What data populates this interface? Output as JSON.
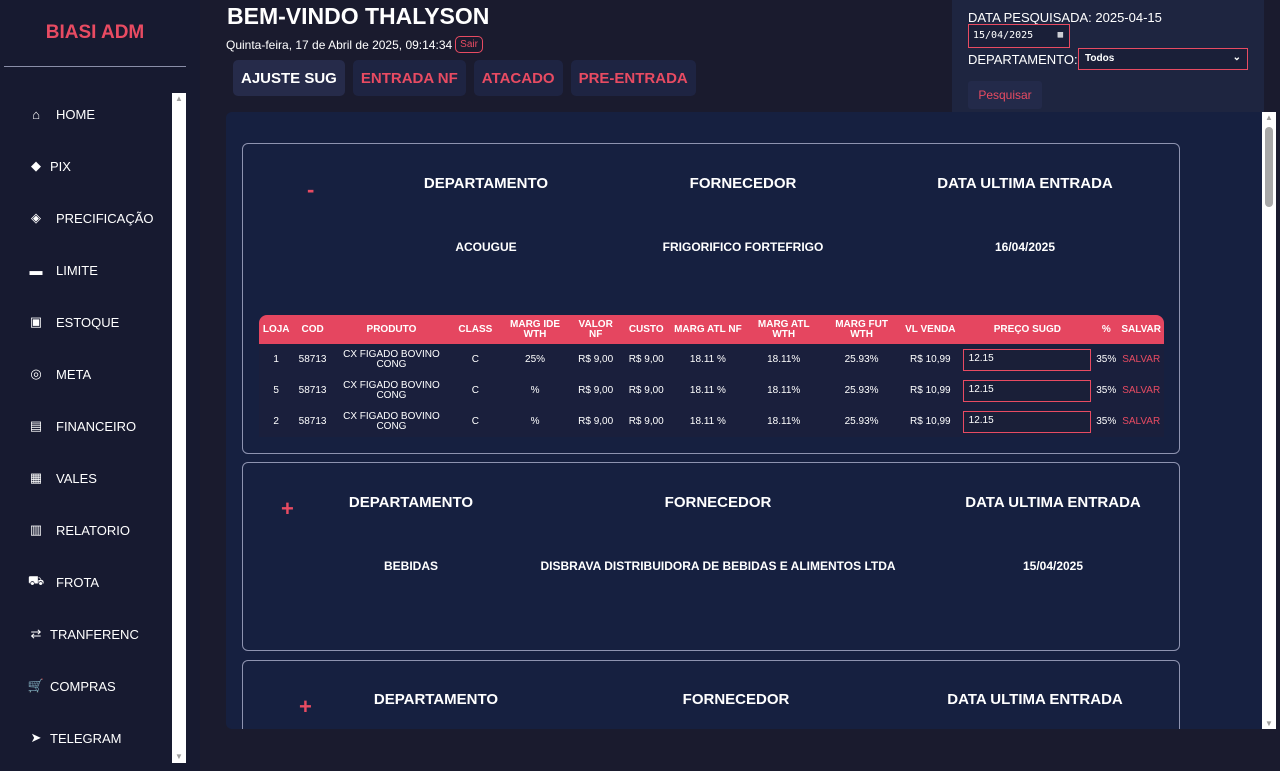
{
  "brand": "BIASI ADM",
  "sidebar": {
    "items": [
      {
        "label": "HOME",
        "icon": "home-icon",
        "glyph": "⌂"
      },
      {
        "label": "PIX",
        "icon": "pix-icon",
        "glyph": "◆"
      },
      {
        "label": "PRECIFICAÇÃO",
        "icon": "tag-icon",
        "glyph": "◈"
      },
      {
        "label": "LIMITE",
        "icon": "credit-card-icon",
        "glyph": "▬"
      },
      {
        "label": "ESTOQUE",
        "icon": "box-icon",
        "glyph": "▣"
      },
      {
        "label": "META",
        "icon": "target-icon",
        "glyph": "◎"
      },
      {
        "label": "FINANCEIRO",
        "icon": "money-icon",
        "glyph": "▤"
      },
      {
        "label": "VALES",
        "icon": "receipt-icon",
        "glyph": "▦"
      },
      {
        "label": "RELATORIO",
        "icon": "chart-icon",
        "glyph": "▥"
      },
      {
        "label": "FROTA",
        "icon": "truck-icon",
        "glyph": "⛟"
      },
      {
        "label": "TRANFERENC",
        "icon": "dolly-icon",
        "glyph": "⇄"
      },
      {
        "label": "COMPRAS",
        "icon": "cart-icon",
        "glyph": "🛒"
      },
      {
        "label": "TELEGRAM",
        "icon": "telegram-icon",
        "glyph": "➤"
      }
    ]
  },
  "header": {
    "welcome": "BEM-VINDO THALYSON",
    "datetime": "Quinta-feira, 17 de Abril de 2025, 09:14:34",
    "logout": "Sair"
  },
  "tabs": [
    {
      "label": "AJUSTE SUG",
      "active": true
    },
    {
      "label": "ENTRADA NF",
      "active": false
    },
    {
      "label": "ATACADO",
      "active": false
    },
    {
      "label": "PRE-ENTRADA",
      "active": false
    }
  ],
  "filter": {
    "date_label": "DATA PESQUISADA: 2025-04-15",
    "date_value": "15/04/2025",
    "dept_label": "DEPARTAMENTO:",
    "dept_value": "Todos",
    "search_button": "Pesquisar"
  },
  "colors": {
    "accent": "#e84b62",
    "background": "#1a1b2e",
    "panel": "#162040"
  },
  "card_headers": {
    "dept": "DEPARTAMENTO",
    "supplier": "FORNECEDOR",
    "last_entry": "DATA ULTIMA ENTRADA"
  },
  "cards": [
    {
      "toggle": "-",
      "dept": "ACOUGUE",
      "supplier": "FRIGORIFICO FORTEFRIGO",
      "last_entry": "16/04/2025"
    },
    {
      "toggle": "+",
      "dept": "BEBIDAS",
      "supplier": "DISBRAVA DISTRIBUIDORA DE BEBIDAS E ALIMENTOS LTDA",
      "last_entry": "15/04/2025"
    },
    {
      "toggle": "+"
    }
  ],
  "table": {
    "columns": [
      "LOJA",
      "COD",
      "PRODUTO",
      "CLASS",
      "MARG IDE WTH",
      "VALOR NF",
      "CUSTO",
      "MARG ATL NF",
      "MARG ATL WTH",
      "MARG FUT WTH",
      "VL VENDA",
      "PREÇO SUGD",
      "%",
      "SALVAR"
    ],
    "rows": [
      {
        "loja": "1",
        "cod": "58713",
        "produto": "CX FIGADO BOVINO CONG",
        "class": "C",
        "marg_ide": "25%",
        "valor_nf": "R$ 9,00",
        "custo": "R$ 9,00",
        "marg_atl_nf": "18.11 %",
        "marg_atl_wth": "18.11%",
        "marg_fut": "25.93%",
        "vl_venda": "R$ 10,99",
        "preco": "12.15",
        "pct": "35%",
        "salvar": "SALVAR"
      },
      {
        "loja": "5",
        "cod": "58713",
        "produto": "CX FIGADO BOVINO CONG",
        "class": "C",
        "marg_ide": "%",
        "valor_nf": "R$ 9,00",
        "custo": "R$ 9,00",
        "marg_atl_nf": "18.11 %",
        "marg_atl_wth": "18.11%",
        "marg_fut": "25.93%",
        "vl_venda": "R$ 10,99",
        "preco": "12.15",
        "pct": "35%",
        "salvar": "SALVAR"
      },
      {
        "loja": "2",
        "cod": "58713",
        "produto": "CX FIGADO BOVINO CONG",
        "class": "C",
        "marg_ide": "%",
        "valor_nf": "R$ 9,00",
        "custo": "R$ 9,00",
        "marg_atl_nf": "18.11 %",
        "marg_atl_wth": "18.11%",
        "marg_fut": "25.93%",
        "vl_venda": "R$ 10,99",
        "preco": "12.15",
        "pct": "35%",
        "salvar": "SALVAR"
      }
    ]
  }
}
